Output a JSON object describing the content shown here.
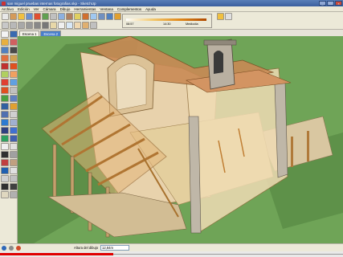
{
  "window": {
    "title": "san miguel pruebas internas fotografias.skp - SketchUp"
  },
  "menu": [
    "Archivo",
    "Edición",
    "Ver",
    "Cámara",
    "Dibujo",
    "Herramientas",
    "Ventana",
    "Complementos",
    "Ayuda"
  ],
  "shadows": {
    "time_label": "08:57",
    "hour_label": "14:30",
    "noon_label": "Mediodía"
  },
  "scenes": {
    "tabs": [
      "Escena 1",
      "Escena 2"
    ],
    "active_index": 1
  },
  "status": {
    "vcb_label": "Altura del dibujo",
    "vcb_value": "12,84m"
  },
  "playback": {
    "progress": 0.33
  },
  "colors": {
    "sky": "#6fa457",
    "scene_active": "#4a7fcb",
    "progress": "#e00000"
  }
}
